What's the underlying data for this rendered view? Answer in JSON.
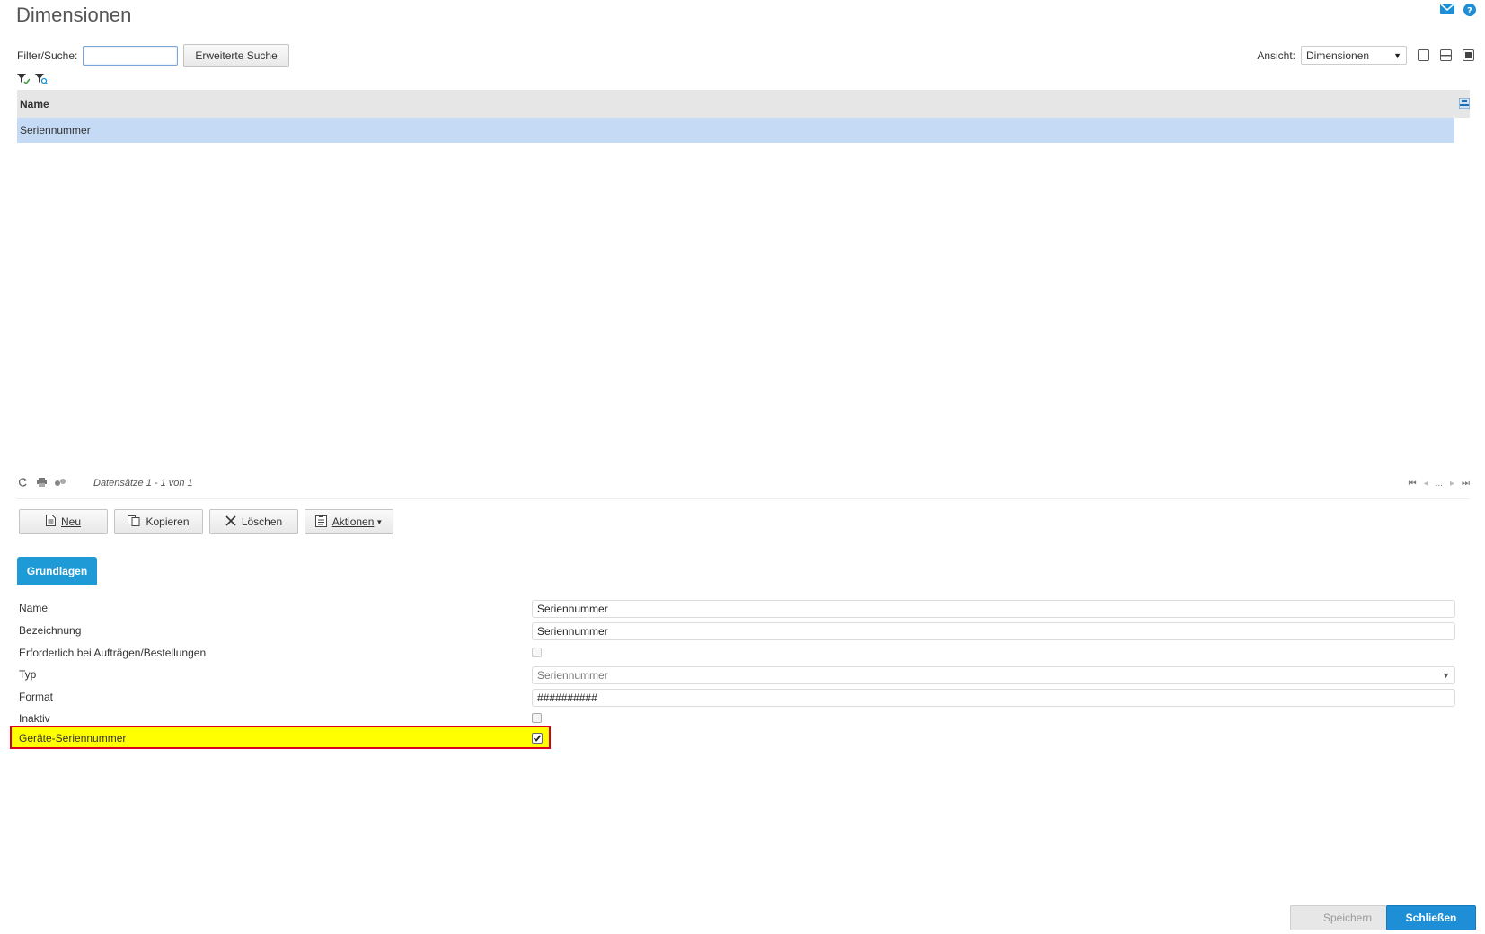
{
  "page": {
    "title": "Dimensionen"
  },
  "filter": {
    "label": "Filter/Suche:",
    "value": "",
    "advanced_button": "Erweiterte Suche"
  },
  "view": {
    "label": "Ansicht:",
    "selected": "Dimensionen"
  },
  "grid": {
    "columns": [
      "Name"
    ],
    "rows": [
      [
        "Seriennummer"
      ]
    ]
  },
  "pager": {
    "info": "Datensätze 1 - 1 von 1",
    "ellipsis": "..."
  },
  "toolbar": {
    "new": "Neu",
    "copy": "Kopieren",
    "delete": "Löschen",
    "actions": "Aktionen"
  },
  "tabs": [
    {
      "label": "Grundlagen",
      "active": true
    }
  ],
  "form": {
    "name_label": "Name",
    "name_value": "Seriennummer",
    "bezeichnung_label": "Bezeichnung",
    "bezeichnung_value": "Seriennummer",
    "required_label": "Erforderlich bei Aufträgen/Bestellungen",
    "typ_label": "Typ",
    "typ_value": "Seriennummer",
    "format_label": "Format",
    "format_value": "##########",
    "inaktiv_label": "Inaktiv",
    "device_serial_label": "Geräte-Seriennummer"
  },
  "footer": {
    "save": "Speichern",
    "close": "Schließen"
  },
  "colors": {
    "accent": "#1e9ad6",
    "selected_row": "#c5daf5",
    "highlight": "#ffff00",
    "highlight_border": "#d8001a"
  }
}
